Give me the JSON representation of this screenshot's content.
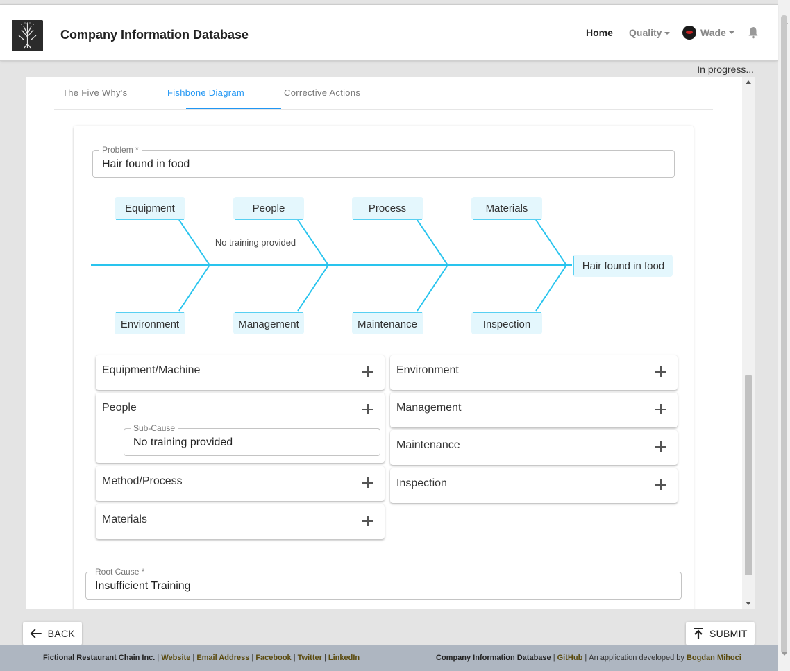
{
  "header": {
    "app_title": "Company Information Database",
    "nav": {
      "home": "Home",
      "quality": "Quality",
      "user": "Wade"
    }
  },
  "status": "In progress...",
  "tabs": [
    {
      "label": "The Five Why's",
      "active": false
    },
    {
      "label": "Fishbone Diagram",
      "active": true
    },
    {
      "label": "Corrective Actions",
      "active": false
    }
  ],
  "problem": {
    "label": "Problem *",
    "value": "Hair found in food"
  },
  "diagram": {
    "head": "Hair found in food",
    "top_categories": [
      "Equipment",
      "People",
      "Process",
      "Materials"
    ],
    "bottom_categories": [
      "Environment",
      "Management",
      "Maintenance",
      "Inspection"
    ],
    "sub_cause_label": "No training provided",
    "line_color": "#29c4ee",
    "box_color": "#e4f7fd"
  },
  "causes": {
    "left": [
      {
        "title": "Equipment/Machine"
      },
      {
        "title": "People",
        "sub_label": "Sub-Cause",
        "sub_value": "No training provided"
      },
      {
        "title": "Method/Process"
      },
      {
        "title": "Materials"
      }
    ],
    "right": [
      {
        "title": "Environment"
      },
      {
        "title": "Management"
      },
      {
        "title": "Maintenance"
      },
      {
        "title": "Inspection"
      }
    ]
  },
  "root_cause": {
    "label": "Root Cause *",
    "value": "Insufficient Training"
  },
  "buttons": {
    "back": "BACK",
    "submit": "SUBMIT"
  },
  "footer": {
    "company": "Fictional Restaurant Chain Inc.",
    "links_left": [
      "Website",
      "Email Address",
      "Facebook",
      "Twitter",
      "LinkedIn"
    ],
    "app": "Company Information Database",
    "github": "GitHub",
    "developed_by": "An application developed by",
    "author": "Bogdan Mihoci"
  },
  "colors": {
    "accent": "#2196f3",
    "footer_bg": "#aeb6c1",
    "footer_link": "#5a4a0e"
  }
}
